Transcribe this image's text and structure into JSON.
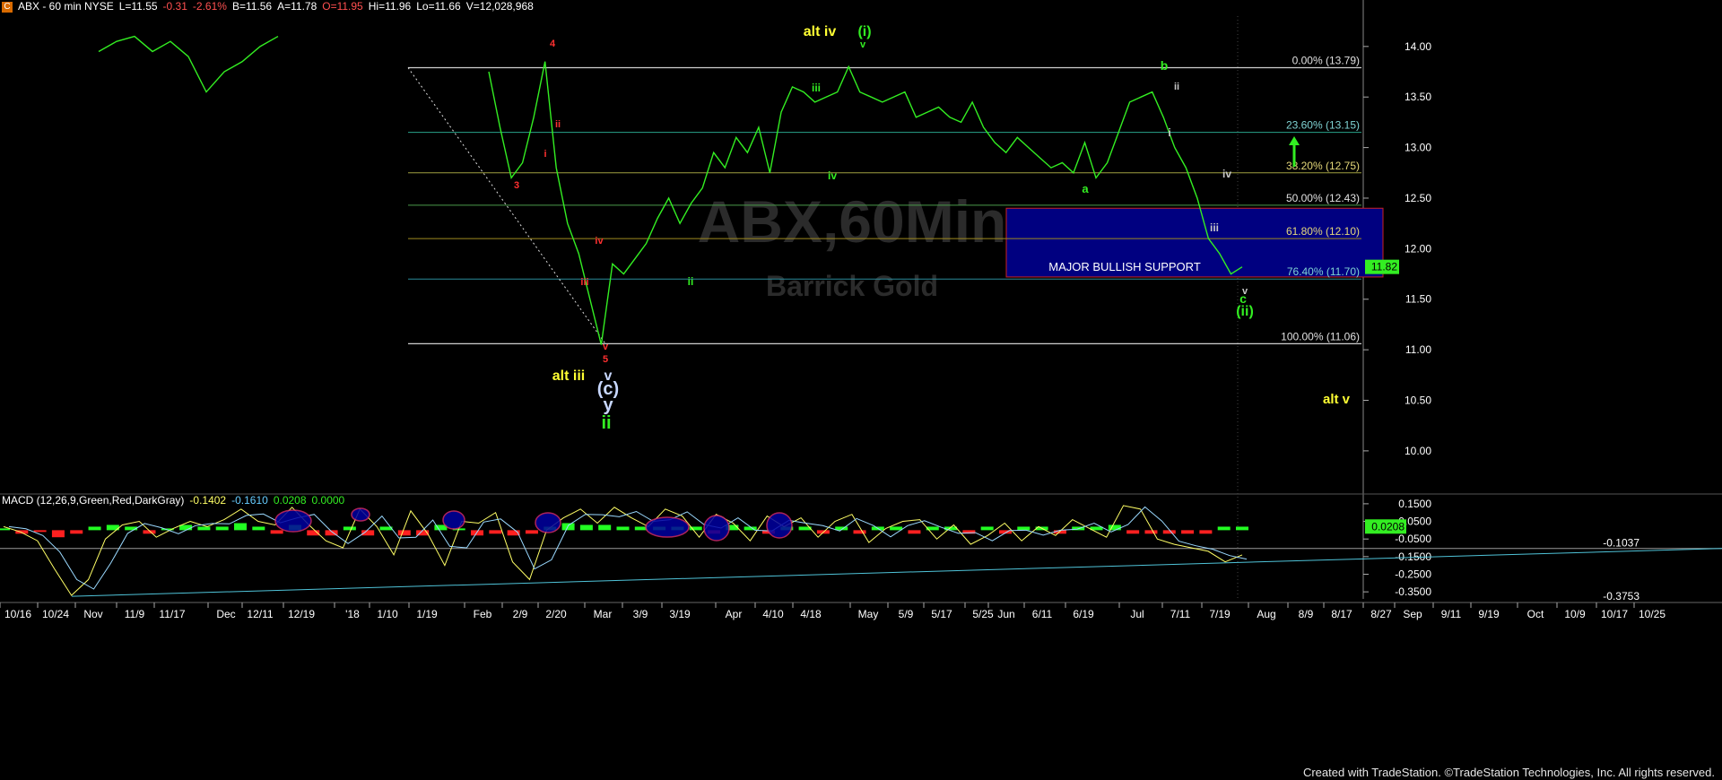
{
  "header": {
    "symbol_icon": "C",
    "title": "ABX - 60 min  NYSE",
    "last": "L=11.55",
    "change": "-0.31",
    "change_pct": "-2.61%",
    "bid": "B=11.56",
    "ask": "A=11.78",
    "open": "O=11.95",
    "high": "Hi=11.96",
    "low": "Lo=11.66",
    "volume": "V=12,028,968"
  },
  "watermark": {
    "symbol": "ABX,60Min",
    "company": "Barrick Gold"
  },
  "colors": {
    "price": "#33ee22",
    "fib": "#c8c8c8",
    "support_box": "#000080",
    "support_border": "#cc2222",
    "macd_up": "#22ff22",
    "macd_down": "#ff2020",
    "trendline": "#4fc3d8"
  },
  "chart_data": [
    {
      "type": "line",
      "title": "ABX - 60 min NYSE",
      "ylim": [
        9.6,
        14.3
      ],
      "yticks": [
        "14.00",
        "13.50",
        "13.00",
        "12.50",
        "12.00",
        "11.50",
        "11.00",
        "10.50",
        "10.00"
      ],
      "ytick_values": [
        14.0,
        13.5,
        13.0,
        12.5,
        12.0,
        11.5,
        11.0,
        10.5,
        10.0
      ],
      "last_price_label": "11.82",
      "last_price": 11.82,
      "x": [
        "10/16",
        "10/24",
        "Nov",
        "11/9",
        "11/17",
        "Dec",
        "12/11",
        "12/19",
        "'18",
        "1/10",
        "1/19",
        "Feb",
        "2/9",
        "2/20",
        "Mar",
        "3/9",
        "3/19",
        "Apr",
        "4/10",
        "4/18",
        "May",
        "5/9",
        "5/17",
        "5/25",
        "Jun",
        "6/11",
        "6/19",
        "Jul",
        "7/11",
        "7/19",
        "Aug",
        "8/9",
        "8/17",
        "8/27",
        "Sep",
        "9/11",
        "9/19",
        "Oct",
        "10/9",
        "10/17",
        "10/25"
      ],
      "series": [
        {
          "values": [
            13.95,
            14.05,
            14.1,
            13.95,
            14.05,
            13.9,
            13.55,
            13.75,
            13.85,
            14.0,
            14.1,
            13.75,
            13.2,
            12.7,
            12.85,
            13.3,
            13.85,
            12.8,
            12.25,
            11.95,
            11.5,
            11.05,
            11.85,
            11.75,
            11.9,
            12.05,
            12.3,
            12.5,
            12.25,
            12.45,
            12.6,
            12.95,
            12.8,
            13.1,
            12.95,
            13.2,
            12.75,
            13.35,
            13.6,
            13.55,
            13.45,
            13.5,
            13.55,
            13.8,
            13.55,
            13.5,
            13.45,
            13.5,
            13.55,
            13.3,
            13.35,
            13.4,
            13.3,
            13.25,
            13.45,
            13.2,
            13.05,
            12.95,
            13.1,
            13.0,
            12.9,
            12.8,
            12.85,
            12.75,
            13.05,
            12.7,
            12.85,
            13.15,
            13.45,
            13.5,
            13.55,
            13.3,
            13.0,
            12.8,
            12.5,
            12.1,
            11.95,
            11.75,
            11.82
          ]
        }
      ],
      "fib_levels": [
        {
          "label": "0.00% (13.79)",
          "value": 13.79
        },
        {
          "label": "23.60% (13.15)",
          "value": 13.15
        },
        {
          "label": "38.20% (12.75)",
          "value": 12.75
        },
        {
          "label": "50.00% (12.43)",
          "value": 12.43
        },
        {
          "label": "61.80% (12.10)",
          "value": 12.1
        },
        {
          "label": "76.40% (11.70)",
          "value": 11.7
        },
        {
          "label": "100.00% (11.06)",
          "value": 11.06
        }
      ],
      "support_zone": {
        "label": "MAJOR BULLISH SUPPORT",
        "top": 12.4,
        "bottom": 11.72
      },
      "annotations": [
        {
          "text": "4",
          "color": "#ff3030"
        },
        {
          "text": "3",
          "color": "#ff3030"
        },
        {
          "text": "ii",
          "color": "#ff3030"
        },
        {
          "text": "i",
          "color": "#ff3030"
        },
        {
          "text": "iv",
          "color": "#ff3030"
        },
        {
          "text": "iii",
          "color": "#ff3030"
        },
        {
          "text": "5",
          "color": "#ff3030"
        },
        {
          "text": "v",
          "color": "#ff3030"
        },
        {
          "text": "alt iii",
          "color": "#ffff33"
        },
        {
          "text": "v",
          "color": "#c8d8ff"
        },
        {
          "text": "(c)",
          "color": "#c8d8ff"
        },
        {
          "text": "y",
          "color": "#c8d8ff"
        },
        {
          "text": "ii",
          "color": "#33ee22"
        },
        {
          "text": "alt iv",
          "color": "#ffff33"
        },
        {
          "text": "(i)",
          "color": "#33ee22"
        },
        {
          "text": "v",
          "color": "#33ee22"
        },
        {
          "text": "iii",
          "color": "#33ee22"
        },
        {
          "text": "iv",
          "color": "#33ee22"
        },
        {
          "text": "ii",
          "color": "#33ee22"
        },
        {
          "text": "b",
          "color": "#33ee22"
        },
        {
          "text": "ii",
          "color": "#c8c8c8"
        },
        {
          "text": "i",
          "color": "#c8c8c8"
        },
        {
          "text": "a",
          "color": "#33ee22"
        },
        {
          "text": "iv",
          "color": "#c8c8c8"
        },
        {
          "text": "iii",
          "color": "#c8c8c8"
        },
        {
          "text": "v",
          "color": "#c8c8c8"
        },
        {
          "text": "c",
          "color": "#33ee22"
        },
        {
          "text": "(ii)",
          "color": "#33ee22"
        },
        {
          "text": "alt v",
          "color": "#ffff33"
        }
      ]
    },
    {
      "type": "line",
      "title": "MACD (12,26,9,Green,Red,DarkGray)",
      "ylim": [
        -0.39,
        0.18
      ],
      "yticks": [
        "0.1500",
        "0.0500",
        "-0.0500",
        "-0.1500",
        "-0.2500",
        "-0.3500"
      ],
      "ytick_values": [
        0.15,
        0.05,
        -0.05,
        -0.15,
        -0.25,
        -0.35
      ],
      "header_values": [
        "-0.1402",
        "-0.1610",
        "0.0208",
        "0.0000"
      ],
      "last_hist_label": "0.0208",
      "last_hist": 0.0208,
      "trendline_labels": [
        "-0.1037",
        "-0.3753"
      ],
      "trendline": {
        "start": -0.3753,
        "end": -0.1037
      },
      "series": [
        {
          "values": [
            0.02,
            -0.01,
            -0.06,
            -0.22,
            -0.37,
            -0.28,
            -0.05,
            0.03,
            0.05,
            -0.04,
            0.01,
            0.05,
            0.02,
            0.06,
            0.12,
            0.05,
            0.03,
            0.13,
            0.03,
            -0.06,
            -0.1,
            0.12,
            0.02,
            -0.14,
            0.11,
            -0.02,
            -0.2,
            0.05,
            0.04,
            0.1,
            -0.18,
            -0.28,
            0.0,
            0.07,
            0.12,
            0.04,
            0.13,
            0.07,
            0.02,
            0.12,
            0.08,
            -0.04,
            0.09,
            0.04,
            -0.06,
            0.08,
            0.02,
            0.07,
            -0.04,
            0.05,
            0.09,
            -0.07,
            0.01,
            0.05,
            0.06,
            -0.05,
            0.03,
            -0.08,
            -0.03,
            0.04,
            -0.06,
            0.02,
            -0.03,
            0.06,
            0.01,
            -0.04,
            0.14,
            0.12,
            -0.05,
            -0.08,
            -0.1,
            -0.12,
            -0.18,
            -0.14
          ]
        }
      ],
      "histogram": [
        0.01,
        -0.02,
        -0.01,
        -0.04,
        -0.02,
        0.02,
        0.03,
        0.02,
        -0.02,
        0.01,
        0.03,
        0.02,
        0.02,
        0.04,
        0.02,
        -0.02,
        0.03,
        -0.03,
        -0.03,
        0.02,
        -0.03,
        0.02,
        -0.03,
        -0.03,
        0.03,
        0.01,
        -0.03,
        -0.02,
        -0.03,
        -0.02,
        0.02,
        0.04,
        0.03,
        0.03,
        0.02,
        0.02,
        0.02,
        0.02,
        0.02,
        -0.02,
        0.03,
        0.02,
        -0.02,
        0.02,
        0.02,
        -0.02,
        0.02,
        -0.02,
        0.02,
        0.02,
        -0.02,
        0.02,
        0.02,
        -0.02,
        0.02,
        -0.02,
        0.02,
        0.02,
        -0.02,
        0.02,
        0.02,
        0.03,
        -0.02,
        -0.02,
        -0.02,
        -0.02,
        -0.02,
        0.02,
        0.02
      ]
    }
  ],
  "footer": {
    "credit": "Created with TradeStation. ©TradeStation Technologies, Inc. All rights reserved."
  }
}
